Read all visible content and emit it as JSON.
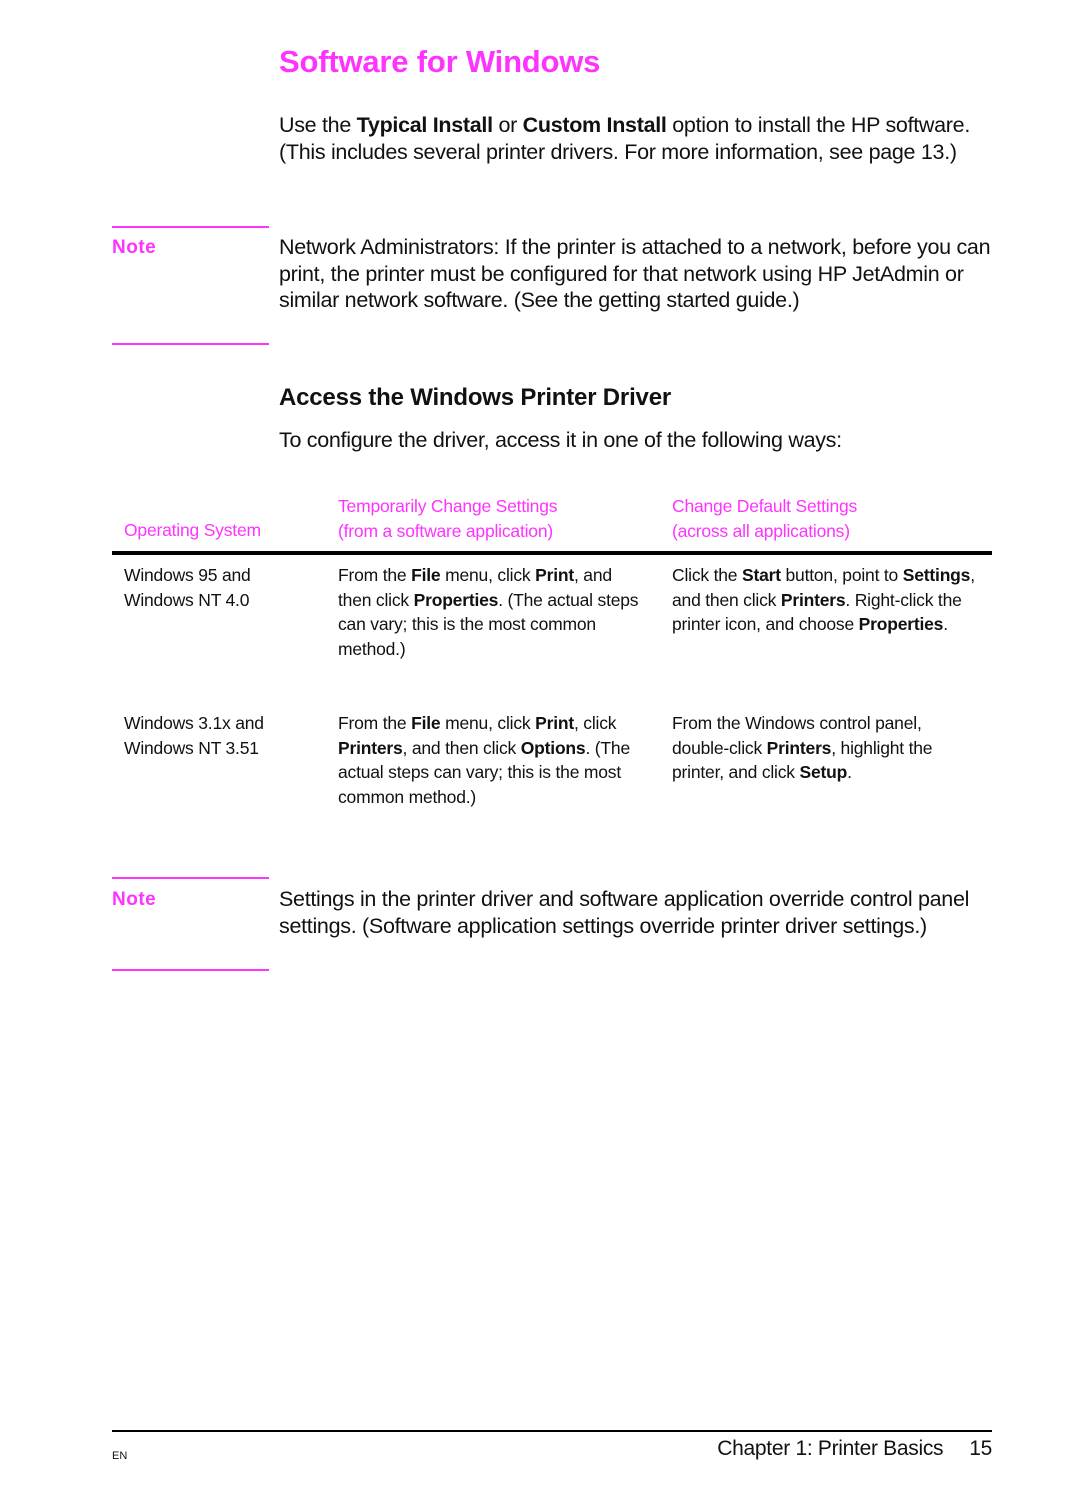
{
  "page": {
    "title": "Software for Windows",
    "intro": {
      "pre": "Use the ",
      "bold1": "Typical Install",
      "mid": " or ",
      "bold2": "Custom Install",
      "post": " option to install the HP software. (This includes several printer drivers. For more information, see page 13.)"
    },
    "note1": {
      "label": "Note",
      "text": "Network Administrators: If the printer is attached to a network, before you can print, the printer must be configured for that network using HP JetAdmin or similar network software. (See the getting started guide.)"
    },
    "section": {
      "heading": "Access the Windows Printer Driver",
      "lead": "To configure the driver, access it in one of the following ways:"
    },
    "table": {
      "headers": {
        "os": "Operating System",
        "temp_line1": "Temporarily Change Settings",
        "temp_line2": "(from a software application)",
        "default_line1": "Change Default Settings",
        "default_line2": "(across all applications)"
      },
      "rows": [
        {
          "os_line1": "Windows 95 and",
          "os_line2": "Windows NT 4.0",
          "temp": [
            {
              "t": "From the "
            },
            {
              "b": "File"
            },
            {
              "t": " menu, click "
            },
            {
              "b": "Print"
            },
            {
              "t": ", and then click "
            },
            {
              "b": "Properties"
            },
            {
              "t": ". (The actual steps can vary; this is the most common method.)"
            }
          ],
          "default": [
            {
              "t": "Click the "
            },
            {
              "b": "Start"
            },
            {
              "t": " button, point to "
            },
            {
              "b": "Settings"
            },
            {
              "t": ", and then click "
            },
            {
              "b": "Printers"
            },
            {
              "t": ". Right-click the printer icon, and choose "
            },
            {
              "b": "Properties"
            },
            {
              "t": "."
            }
          ]
        },
        {
          "os_line1": "Windows 3.1x and",
          "os_line2": "Windows NT 3.51",
          "temp": [
            {
              "t": "From the "
            },
            {
              "b": "File"
            },
            {
              "t": " menu, click "
            },
            {
              "b": "Print"
            },
            {
              "t": ", click "
            },
            {
              "b": "Printers"
            },
            {
              "t": ", and then click "
            },
            {
              "b": "Options"
            },
            {
              "t": ". (The actual steps can vary; this is the most common method.)"
            }
          ],
          "default": [
            {
              "t": "From the Windows control panel, double-click "
            },
            {
              "b": "Printers"
            },
            {
              "t": ", highlight the printer, and click "
            },
            {
              "b": "Setup"
            },
            {
              "t": "."
            }
          ]
        }
      ]
    },
    "note2": {
      "label": "Note",
      "text": "Settings in the printer driver and software application override control panel settings. (Software application settings override printer driver settings.)"
    },
    "footer": {
      "lang": "EN",
      "chapter": "Chapter 1:  Printer Basics",
      "page_number": "15"
    }
  },
  "colors": {
    "accent": "#ff33ff",
    "text": "#111111"
  }
}
